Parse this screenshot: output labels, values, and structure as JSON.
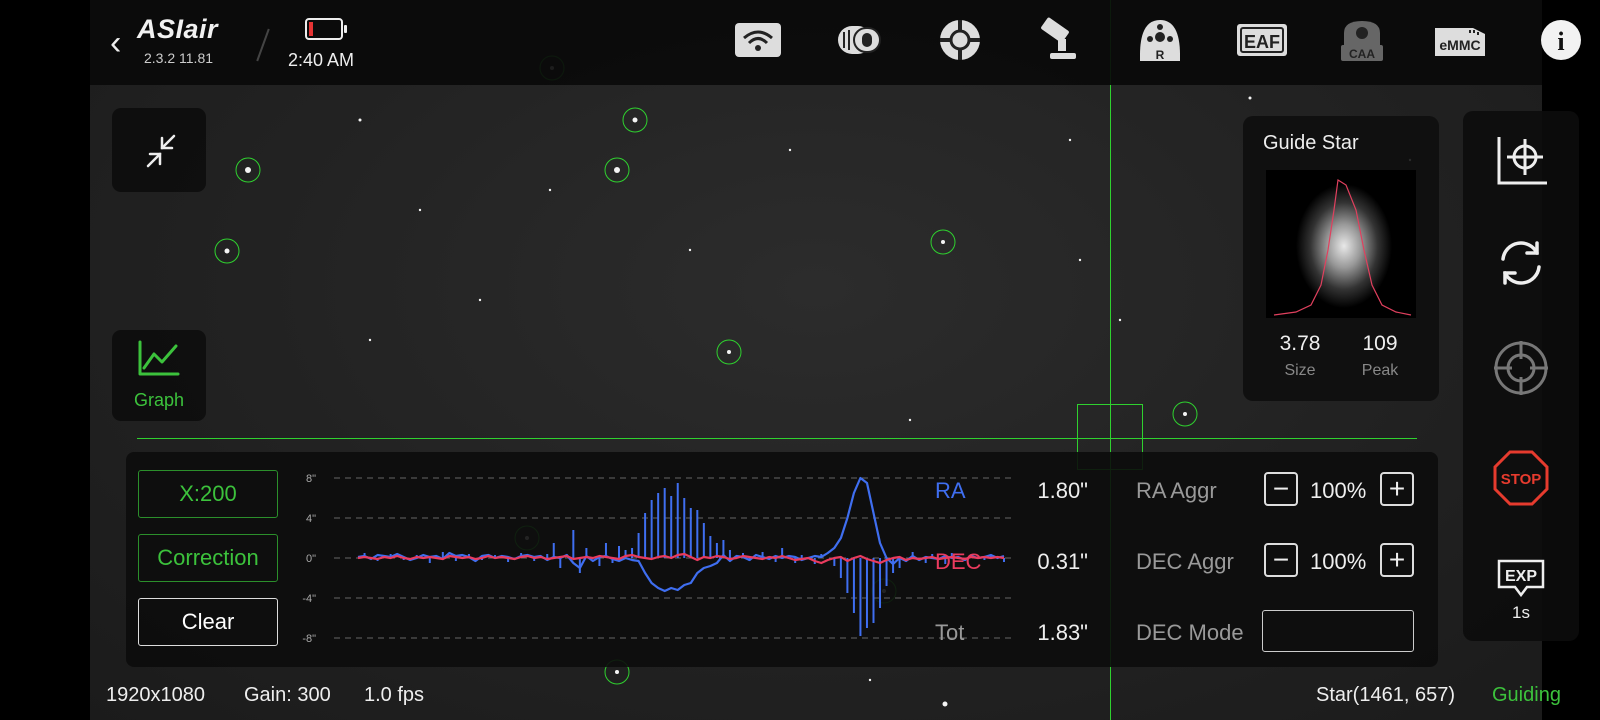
{
  "app": {
    "back_icon": "chevron-left-icon",
    "logo": "ASIair",
    "version": "2.3.2 11.81",
    "time": "2:40 AM",
    "battery_icon": "battery-low-icon"
  },
  "toolbar": {
    "icons": [
      "wifi-icon",
      "camera-icon",
      "guide-scope-icon",
      "telescope-mount-icon",
      "rotator-icon",
      "eaf-icon",
      "caa-icon",
      "emmc-icon",
      "info-icon"
    ],
    "rotator_label": "R",
    "eaf_label": "EAF",
    "caa_label": "CAA",
    "emmc_label": "eMMC",
    "info_label": "i"
  },
  "left": {
    "collapse_icon": "collapse-icon",
    "graph_icon": "graph-icon",
    "graph_label": "Graph"
  },
  "guide_star": {
    "title": "Guide Star",
    "size_value": "3.78",
    "size_label": "Size",
    "peak_value": "109",
    "peak_label": "Peak"
  },
  "right": {
    "calibrate_icon": "calibrate-target-icon",
    "loop_icon": "loop-refresh-icon",
    "guide_icon": "guide-target-icon",
    "stop_label": "STOP",
    "exp_label": "EXP",
    "exposure_value": "1s"
  },
  "graph_panel": {
    "x_scale_label": "X:200",
    "correction_label": "Correction",
    "clear_label": "Clear",
    "ra_label": "RA",
    "ra_value": "1.80\"",
    "dec_label": "DEC",
    "dec_value": "0.31\"",
    "tot_label": "Tot",
    "tot_value": "1.83\"",
    "ra_aggr_label": "RA Aggr",
    "ra_aggr_value": "100%",
    "dec_aggr_label": "DEC Aggr",
    "dec_aggr_value": "100%",
    "dec_mode_label": "DEC Mode",
    "dec_mode_value": "",
    "minus": "−",
    "plus": "+"
  },
  "status": {
    "resolution": "1920x1080",
    "gain": "Gain: 300",
    "fps": "1.0 fps",
    "star": "Star(1461, 657)",
    "state": "Guiding"
  },
  "colors": {
    "accent_green": "#3cc23c",
    "ra_blue": "#3f6ef0",
    "dec_red": "#ea3b5e",
    "stop_red": "#e63b2e"
  },
  "chart_data": {
    "type": "line",
    "ylim": [
      -8,
      8
    ],
    "yticks": [
      "8\"",
      "4\"",
      "0\"",
      "-4\"",
      "-8\""
    ],
    "series": [
      {
        "name": "RA",
        "color": "#3f6ef0",
        "values": [
          0.1,
          0.2,
          -0.1,
          0.3,
          0.2,
          0.1,
          0.4,
          0.1,
          -0.2,
          0.0,
          0.3,
          0.1,
          0.2,
          -0.1,
          0.5,
          0.2,
          0.3,
          0.1,
          -0.3,
          0.2,
          0.3,
          0.0,
          0.2,
          0.1,
          -0.1,
          0.2,
          0.3,
          0.1,
          0.2,
          -0.2,
          0.1,
          0.0,
          0.3,
          -0.5,
          -1.0,
          0.2,
          -0.3,
          0.1,
          0.2,
          -0.1,
          -0.3,
          0.0,
          -0.2,
          -0.3,
          -1.5,
          -2.5,
          -3.0,
          -3.3,
          -3.0,
          -3.2,
          -2.7,
          -2.5,
          -1.5,
          -1.0,
          -0.8,
          -0.5,
          0.3,
          -0.3,
          0.2,
          0.1,
          -0.2,
          0.3,
          0.1,
          -0.1,
          0.2,
          0.0,
          0.2,
          0.1,
          -0.2,
          0.0,
          0.2,
          0.1,
          0.5,
          1.0,
          2.0,
          4.0,
          6.5,
          8.0,
          7.5,
          4.5,
          1.5,
          0.0,
          -0.6,
          0.0,
          -0.3,
          0.2,
          -0.2,
          0.1,
          0.0,
          -0.1,
          0.2,
          0.0,
          0.1,
          -0.2,
          0.2,
          0.0,
          0.1,
          0.3,
          0.0,
          0.2
        ]
      },
      {
        "name": "DEC",
        "color": "#ea3b5e",
        "values": [
          0.0,
          0.1,
          0.0,
          -0.1,
          0.1,
          0.0,
          0.2,
          0.0,
          -0.1,
          0.1,
          0.0,
          0.1,
          0.0,
          -0.1,
          0.2,
          0.1,
          0.0,
          0.1,
          -0.1,
          0.0,
          0.2,
          0.0,
          0.1,
          0.0,
          -0.1,
          0.1,
          0.2,
          0.0,
          0.1,
          -0.1,
          0.0,
          0.1,
          0.2,
          -0.1,
          0.0,
          0.1,
          0.0,
          0.2,
          0.1,
          0.0,
          -0.1,
          0.2,
          0.3,
          0.1,
          0.0,
          -0.1,
          0.1,
          0.2,
          0.0,
          0.3,
          0.4,
          0.1,
          -0.2,
          0.1,
          0.0,
          0.2,
          0.1,
          -0.1,
          0.0,
          0.2,
          0.1,
          0.0,
          -0.1,
          0.1,
          0.0,
          0.2,
          0.0,
          -0.2,
          -0.1,
          0.0,
          -0.3,
          -0.5,
          -0.2,
          0.0,
          0.1,
          -0.3,
          0.0,
          0.2,
          -0.1,
          -0.3,
          -0.5,
          -0.2,
          0.0,
          0.1,
          -0.2,
          0.0,
          -0.1,
          0.0,
          0.1,
          -0.1,
          0.0,
          0.1,
          0.0,
          -0.1,
          0.1,
          0.0,
          0.1,
          0.0,
          0.1,
          0.0
        ]
      },
      {
        "name": "RA correction",
        "color": "#3f6ef0",
        "values": [
          0,
          0.5,
          0,
          -0.3,
          0,
          0.4,
          0,
          -0.2,
          0,
          0.3,
          0,
          -0.5,
          0,
          0.6,
          0,
          -0.3,
          0,
          0.4,
          0,
          -0.2,
          0,
          0.3,
          0,
          -0.4,
          0,
          0.5,
          0,
          -0.3,
          0,
          0.4,
          1.5,
          -1.0,
          0,
          2.8,
          -1.5,
          1.0,
          0,
          -0.8,
          1.5,
          -0.5,
          1.2,
          0.8,
          1.0,
          2.5,
          4.5,
          5.8,
          6.5,
          7.0,
          6.2,
          7.5,
          6.0,
          5.0,
          4.8,
          3.5,
          2.2,
          1.5,
          1.8,
          0.8,
          0,
          0.5,
          -0.3,
          0,
          0.6,
          0,
          -0.4,
          1.0,
          0,
          -0.5,
          0.3,
          0,
          -0.6,
          0.4,
          0,
          -0.8,
          -2.0,
          -3.5,
          -5.5,
          -7.8,
          -7.0,
          -6.5,
          -5.0,
          -2.8,
          -1.5,
          -1.0,
          0,
          0.6,
          0,
          -0.5,
          0.4,
          0,
          -0.6,
          0.5,
          0,
          -0.3,
          0.4,
          0,
          -0.2,
          0.3,
          0,
          -0.4
        ]
      }
    ]
  }
}
